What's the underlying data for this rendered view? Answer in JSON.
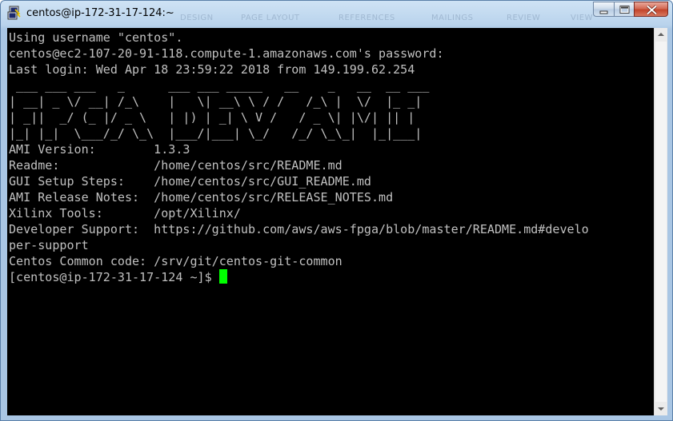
{
  "window": {
    "title": "centos@ip-172-31-17-124:~",
    "background_ribbon_tabs": [
      "DESIGN",
      "PAGE LAYOUT",
      "REFERENCES",
      "MAILINGS",
      "REVIEW",
      "VIEW"
    ]
  },
  "terminal": {
    "colors": {
      "background": "#000000",
      "foreground": "#c0c0c0",
      "cursor": "#00ff00"
    },
    "lines": [
      "Using username \"centos\".",
      "centos@ec2-107-20-91-118.compute-1.amazonaws.com's password:",
      "Last login: Wed Apr 18 23:59:22 2018 from 149.199.62.254",
      " ___ ___ ___   _      ___ ___ _____   __    _   __  __ ___ ",
      "| __| _ \\/ __| /_\\    |   \\| __\\ \\ / /   /_\\ |  \\/  |_ _|",
      "| _||  _/ (_ |/ _ \\   | |) | _| \\ V /   / _ \\| |\\/| || | ",
      "|_| |_|  \\___/_/ \\_\\  |___/|___| \\_/   /_/ \\_\\_|  |_|___|",
      "AMI Version:        1.3.3",
      "Readme:             /home/centos/src/README.md",
      "GUI Setup Steps:    /home/centos/src/GUI_README.md",
      "AMI Release Notes:  /home/centos/src/RELEASE_NOTES.md",
      "Xilinx Tools:       /opt/Xilinx/",
      "Developer Support:  https://github.com/aws/aws-fpga/blob/master/README.md#develo",
      "per-support",
      "Centos Common code: /srv/git/centos-git-common"
    ],
    "prompt": "[centos@ip-172-31-17-124 ~]$ "
  },
  "icons": {
    "app": "putty-icon",
    "minimize": "minimize-icon",
    "maximize": "maximize-icon",
    "close": "close-icon",
    "scroll_up": "scroll-up-arrow-icon",
    "scroll_down": "scroll-down-arrow-icon"
  }
}
